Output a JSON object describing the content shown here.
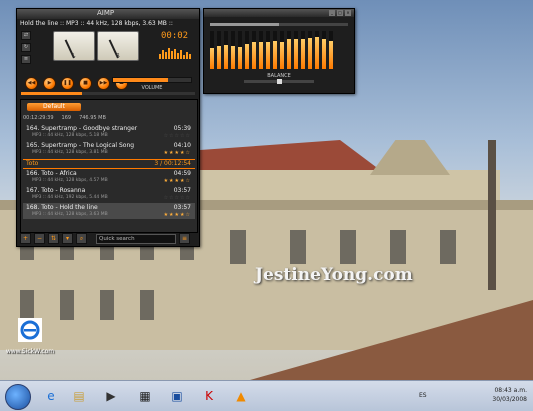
{
  "desktop": {
    "watermark": "JestineYong.com",
    "icon_label": "www.SickW.com"
  },
  "player": {
    "logo": "AIMP",
    "now_playing": "Hold the line :: MP3 :: 44 kHz, 128 kbps, 3.63 MB ::",
    "vu_left": "L",
    "vu_right": "R",
    "time": "00:02",
    "volume_label": "VOLUME",
    "volume_level": 0.7,
    "seek_level": 0.35,
    "playlist_tab": "Default",
    "playlist_info": {
      "duration": "00:12:29:39",
      "count": "169",
      "size": "746.95 MB"
    },
    "rows": [
      {
        "title": "164. Supertramp - Goodbye stranger",
        "length": "05:39",
        "meta": "MP3 :: 44 kHz, 128 kbps, 5.18 MB",
        "stars": "☆☆☆☆☆",
        "rated": false
      },
      {
        "title": "165. Supertramp - The Logical Song",
        "length": "04:10",
        "meta": "MP3 :: 44 kHz, 128 kbps, 3.81 MB",
        "stars": "★★★★☆",
        "rated": true
      }
    ],
    "group": {
      "name": "Toto",
      "count": "3 / 00:12:54"
    },
    "rows2": [
      {
        "title": "166. Toto - Africa",
        "length": "04:59",
        "meta": "MP3 :: 44 kHz, 128 kbps, 4.57 MB",
        "stars": "★★★★☆",
        "rated": true,
        "selected": false
      },
      {
        "title": "167. Toto - Rosanna",
        "length": "03:57",
        "meta": "MP3 :: 44 kHz, 192 kbps, 5.44 MB",
        "stars": "☆☆☆☆☆",
        "rated": false,
        "selected": false
      },
      {
        "title": "168. Toto - Hold the line",
        "length": "03:57",
        "meta": "MP3 :: 44 kHz, 128 kbps, 3.63 MB",
        "stars": "★★★★☆",
        "rated": true,
        "selected": true
      }
    ],
    "quick_search": "Quick search"
  },
  "equalizer": {
    "balance_label": "BALANCE",
    "bands": [
      0.55,
      0.6,
      0.62,
      0.6,
      0.58,
      0.65,
      0.7,
      0.72,
      0.7,
      0.75,
      0.72,
      0.78,
      0.8,
      0.78,
      0.82,
      0.85,
      0.8,
      0.75
    ]
  },
  "taskbar": {
    "lang": "ES",
    "time": "08:43 a.m.",
    "date": "30/03/2008"
  },
  "colors": {
    "accent": "#ff8a1a",
    "player_bg": "#1e1e1e"
  }
}
